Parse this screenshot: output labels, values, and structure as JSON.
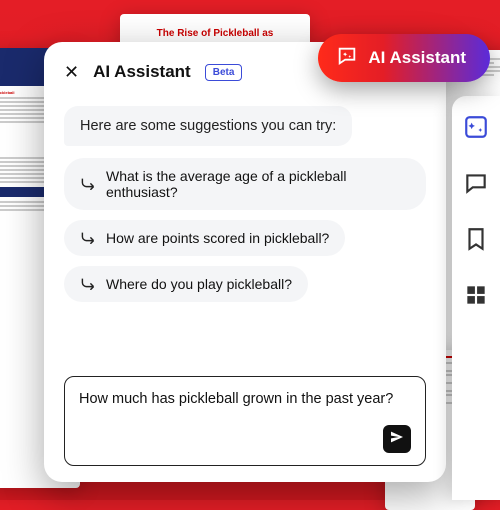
{
  "background_docs": {
    "center_title": "The Rise of Pickleball as"
  },
  "pill": {
    "label": "AI Assistant"
  },
  "panel": {
    "title": "AI Assistant",
    "badge": "Beta",
    "intro": "Here are some suggestions you can try:",
    "suggestions": [
      "What is the average age of a pickleball enthusiast?",
      "How are points scored in pickleball?",
      "Where do you play pickleball?"
    ],
    "input_value": "How much has pickleball grown in the past year?"
  },
  "rail": {
    "items": [
      "ai-assistant",
      "comments",
      "bookmark",
      "thumbnails"
    ]
  }
}
